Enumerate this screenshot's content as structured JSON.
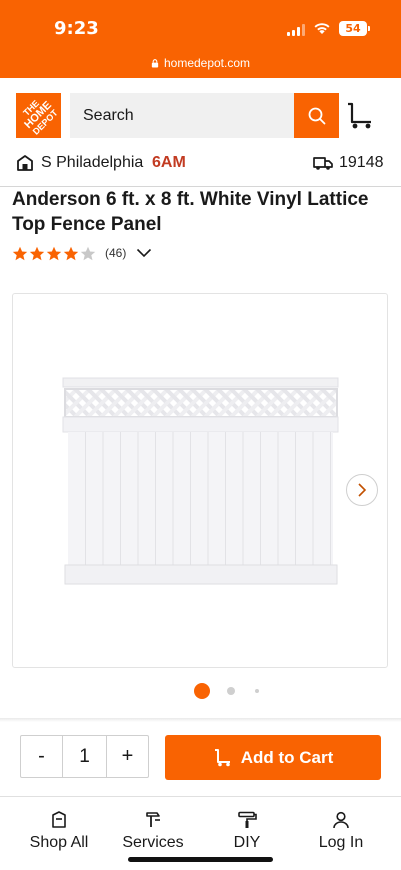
{
  "status_bar": {
    "time": "9:23",
    "battery": "54"
  },
  "browser": {
    "url": "homedepot.com"
  },
  "header": {
    "logo_text": [
      "THE",
      "HOME",
      "DEPOT"
    ],
    "search_placeholder": "Search"
  },
  "location": {
    "store_name": "S Philadelphia",
    "store_hours": "6AM",
    "zip": "19148"
  },
  "product": {
    "title": "Anderson 6 ft. x 8 ft. White Vinyl Lattice Top Fence Panel",
    "rating": 4,
    "rating_max": 5,
    "review_count": "(46)",
    "image_carousel": {
      "current_index": 1,
      "total_dots": 3
    }
  },
  "purchase": {
    "minus_label": "-",
    "quantity": "1",
    "plus_label": "+",
    "add_to_cart_label": "Add to Cart"
  },
  "bottom_nav": {
    "items": [
      {
        "label": "Shop All",
        "icon": "shopping-bag-icon"
      },
      {
        "label": "Services",
        "icon": "tools-icon"
      },
      {
        "label": "DIY",
        "icon": "paint-roller-icon"
      },
      {
        "label": "Log In",
        "icon": "user-icon"
      }
    ]
  },
  "colors": {
    "brand_orange": "#f96302",
    "hours_red": "#c23b22",
    "star": "#f96302"
  }
}
